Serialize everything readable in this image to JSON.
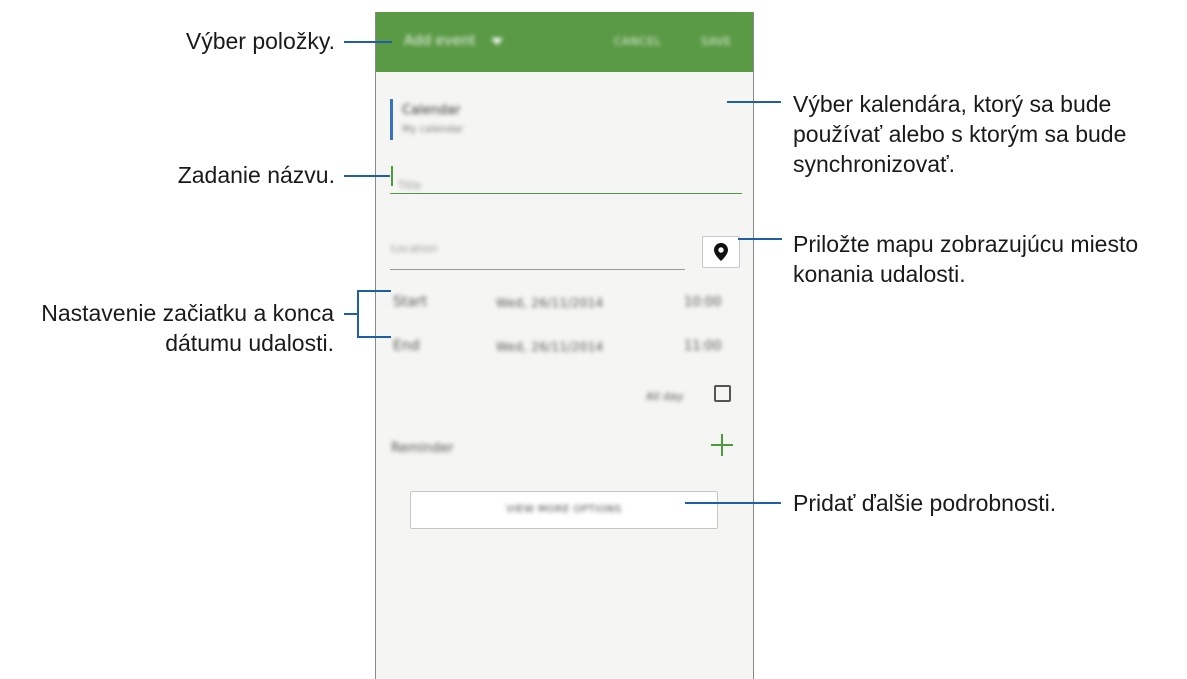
{
  "app": {
    "title": "Add event",
    "cancel": "CANCEL",
    "save": "SAVE"
  },
  "calendar": {
    "name": "Calendar",
    "account": "My calendar"
  },
  "title_field": {
    "placeholder": "Title"
  },
  "location_field": {
    "placeholder": "Location"
  },
  "start": {
    "label": "Start",
    "date": "Wed, 26/11/2014",
    "time": "10:00"
  },
  "end": {
    "label": "End",
    "date": "Wed, 26/11/2014",
    "time": "11:00"
  },
  "all_day": {
    "label": "All day",
    "checked": false
  },
  "reminder": {
    "label": "Reminder"
  },
  "more_options": {
    "label": "VIEW MORE OPTIONS"
  },
  "colors": {
    "appbar": "#5a9a45",
    "accent": "#4d9b3f",
    "calendar_color": "#3a72c2",
    "callout_line": "#1f5fa8"
  },
  "icons": {
    "dropdown": "caret-down-icon",
    "map": "map-pin-icon",
    "add": "plus-icon",
    "checkbox": "checkbox-icon"
  },
  "callouts": {
    "item_select": "Výber položky.",
    "calendar_l1": "Výber kalendára, ktorý sa bude",
    "calendar_l2": "používať alebo s ktorým sa bude",
    "calendar_l3": "synchronizovať.",
    "title": "Zadanie názvu.",
    "map_l1": "Priložte mapu zobrazujúcu miesto",
    "map_l2": "konania udalosti.",
    "dates_l1": "Nastavenie začiatku a konca",
    "dates_l2": "dátumu udalosti.",
    "details": "Pridať ďalšie podrobnosti."
  }
}
